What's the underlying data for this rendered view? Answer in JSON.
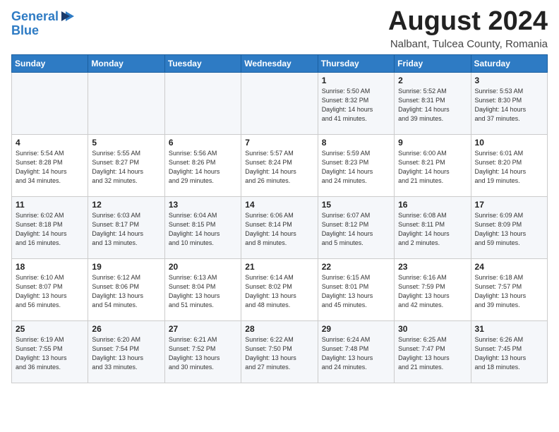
{
  "header": {
    "logo_line1": "General",
    "logo_line2": "Blue",
    "main_title": "August 2024",
    "subtitle": "Nalbant, Tulcea County, Romania"
  },
  "days_of_week": [
    "Sunday",
    "Monday",
    "Tuesday",
    "Wednesday",
    "Thursday",
    "Friday",
    "Saturday"
  ],
  "weeks": [
    [
      {
        "day": "",
        "info": ""
      },
      {
        "day": "",
        "info": ""
      },
      {
        "day": "",
        "info": ""
      },
      {
        "day": "",
        "info": ""
      },
      {
        "day": "1",
        "info": "Sunrise: 5:50 AM\nSunset: 8:32 PM\nDaylight: 14 hours\nand 41 minutes."
      },
      {
        "day": "2",
        "info": "Sunrise: 5:52 AM\nSunset: 8:31 PM\nDaylight: 14 hours\nand 39 minutes."
      },
      {
        "day": "3",
        "info": "Sunrise: 5:53 AM\nSunset: 8:30 PM\nDaylight: 14 hours\nand 37 minutes."
      }
    ],
    [
      {
        "day": "4",
        "info": "Sunrise: 5:54 AM\nSunset: 8:28 PM\nDaylight: 14 hours\nand 34 minutes."
      },
      {
        "day": "5",
        "info": "Sunrise: 5:55 AM\nSunset: 8:27 PM\nDaylight: 14 hours\nand 32 minutes."
      },
      {
        "day": "6",
        "info": "Sunrise: 5:56 AM\nSunset: 8:26 PM\nDaylight: 14 hours\nand 29 minutes."
      },
      {
        "day": "7",
        "info": "Sunrise: 5:57 AM\nSunset: 8:24 PM\nDaylight: 14 hours\nand 26 minutes."
      },
      {
        "day": "8",
        "info": "Sunrise: 5:59 AM\nSunset: 8:23 PM\nDaylight: 14 hours\nand 24 minutes."
      },
      {
        "day": "9",
        "info": "Sunrise: 6:00 AM\nSunset: 8:21 PM\nDaylight: 14 hours\nand 21 minutes."
      },
      {
        "day": "10",
        "info": "Sunrise: 6:01 AM\nSunset: 8:20 PM\nDaylight: 14 hours\nand 19 minutes."
      }
    ],
    [
      {
        "day": "11",
        "info": "Sunrise: 6:02 AM\nSunset: 8:18 PM\nDaylight: 14 hours\nand 16 minutes."
      },
      {
        "day": "12",
        "info": "Sunrise: 6:03 AM\nSunset: 8:17 PM\nDaylight: 14 hours\nand 13 minutes."
      },
      {
        "day": "13",
        "info": "Sunrise: 6:04 AM\nSunset: 8:15 PM\nDaylight: 14 hours\nand 10 minutes."
      },
      {
        "day": "14",
        "info": "Sunrise: 6:06 AM\nSunset: 8:14 PM\nDaylight: 14 hours\nand 8 minutes."
      },
      {
        "day": "15",
        "info": "Sunrise: 6:07 AM\nSunset: 8:12 PM\nDaylight: 14 hours\nand 5 minutes."
      },
      {
        "day": "16",
        "info": "Sunrise: 6:08 AM\nSunset: 8:11 PM\nDaylight: 14 hours\nand 2 minutes."
      },
      {
        "day": "17",
        "info": "Sunrise: 6:09 AM\nSunset: 8:09 PM\nDaylight: 13 hours\nand 59 minutes."
      }
    ],
    [
      {
        "day": "18",
        "info": "Sunrise: 6:10 AM\nSunset: 8:07 PM\nDaylight: 13 hours\nand 56 minutes."
      },
      {
        "day": "19",
        "info": "Sunrise: 6:12 AM\nSunset: 8:06 PM\nDaylight: 13 hours\nand 54 minutes."
      },
      {
        "day": "20",
        "info": "Sunrise: 6:13 AM\nSunset: 8:04 PM\nDaylight: 13 hours\nand 51 minutes."
      },
      {
        "day": "21",
        "info": "Sunrise: 6:14 AM\nSunset: 8:02 PM\nDaylight: 13 hours\nand 48 minutes."
      },
      {
        "day": "22",
        "info": "Sunrise: 6:15 AM\nSunset: 8:01 PM\nDaylight: 13 hours\nand 45 minutes."
      },
      {
        "day": "23",
        "info": "Sunrise: 6:16 AM\nSunset: 7:59 PM\nDaylight: 13 hours\nand 42 minutes."
      },
      {
        "day": "24",
        "info": "Sunrise: 6:18 AM\nSunset: 7:57 PM\nDaylight: 13 hours\nand 39 minutes."
      }
    ],
    [
      {
        "day": "25",
        "info": "Sunrise: 6:19 AM\nSunset: 7:55 PM\nDaylight: 13 hours\nand 36 minutes."
      },
      {
        "day": "26",
        "info": "Sunrise: 6:20 AM\nSunset: 7:54 PM\nDaylight: 13 hours\nand 33 minutes."
      },
      {
        "day": "27",
        "info": "Sunrise: 6:21 AM\nSunset: 7:52 PM\nDaylight: 13 hours\nand 30 minutes."
      },
      {
        "day": "28",
        "info": "Sunrise: 6:22 AM\nSunset: 7:50 PM\nDaylight: 13 hours\nand 27 minutes."
      },
      {
        "day": "29",
        "info": "Sunrise: 6:24 AM\nSunset: 7:48 PM\nDaylight: 13 hours\nand 24 minutes."
      },
      {
        "day": "30",
        "info": "Sunrise: 6:25 AM\nSunset: 7:47 PM\nDaylight: 13 hours\nand 21 minutes."
      },
      {
        "day": "31",
        "info": "Sunrise: 6:26 AM\nSunset: 7:45 PM\nDaylight: 13 hours\nand 18 minutes."
      }
    ]
  ]
}
